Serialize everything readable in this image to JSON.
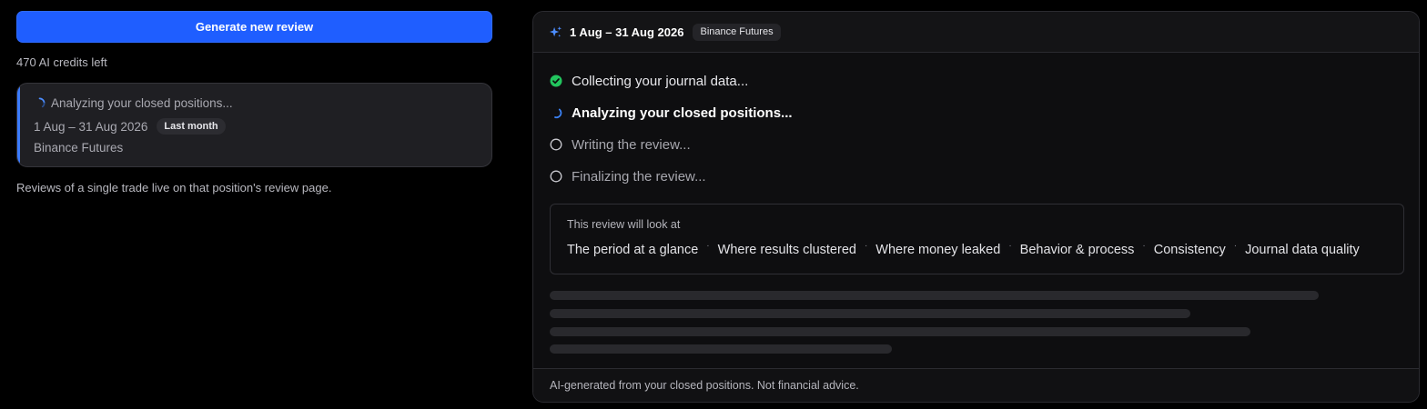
{
  "left": {
    "generate_button_label": "Generate new review",
    "credits_text": "470 AI credits left",
    "job_card": {
      "status_text": "Analyzing your closed positions...",
      "date_range": "1 Aug – 31 Aug 2026",
      "period_badge": "Last month",
      "exchange": "Binance Futures"
    },
    "single_trade_note": "Reviews of a single trade live on that position's review page."
  },
  "panel": {
    "header": {
      "icon": "sparkle-icon",
      "title": "1 Aug – 31 Aug 2026",
      "exchange_badge": "Binance Futures"
    },
    "steps": [
      {
        "label": "Collecting your journal data...",
        "state": "done",
        "icon": "check-circle-icon"
      },
      {
        "label": "Analyzing your closed positions...",
        "state": "active",
        "icon": "spinner-icon"
      },
      {
        "label": "Writing the review...",
        "state": "pending",
        "icon": "empty-circle-icon"
      },
      {
        "label": "Finalizing the review...",
        "state": "pending",
        "icon": "empty-circle-icon"
      }
    ],
    "scope": {
      "label": "This review will look at",
      "items": [
        "The period at a glance",
        "Where results clustered",
        "Where money leaked",
        "Behavior & process",
        "Consistency",
        "Journal data quality"
      ],
      "separator": "·"
    },
    "footer_text": "AI-generated from your closed positions. Not financial advice."
  },
  "colors": {
    "accent": "#1f5eff",
    "success": "#22c55e",
    "spinner": "#3b82f6",
    "sparkle": "#4c8dff"
  }
}
